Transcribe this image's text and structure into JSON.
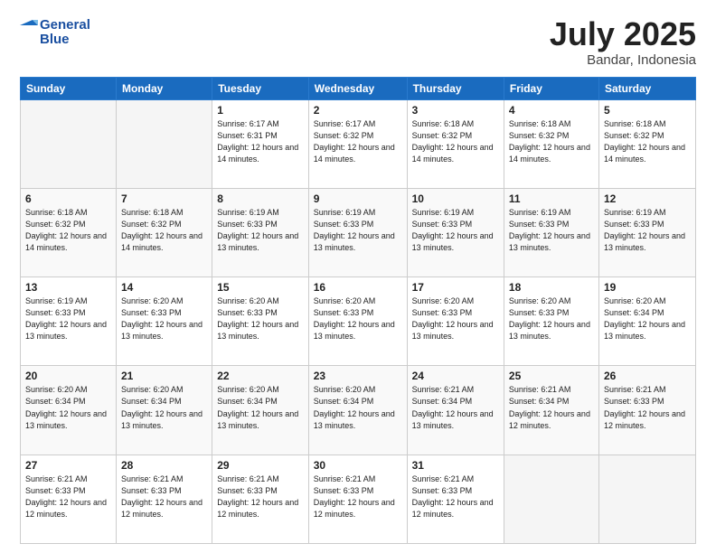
{
  "header": {
    "logo_line1": "General",
    "logo_line2": "Blue",
    "title": "July 2025",
    "location": "Bandar, Indonesia"
  },
  "weekdays": [
    "Sunday",
    "Monday",
    "Tuesday",
    "Wednesday",
    "Thursday",
    "Friday",
    "Saturday"
  ],
  "weeks": [
    [
      {
        "day": "",
        "info": ""
      },
      {
        "day": "",
        "info": ""
      },
      {
        "day": "1",
        "info": "Sunrise: 6:17 AM\nSunset: 6:31 PM\nDaylight: 12 hours and 14 minutes."
      },
      {
        "day": "2",
        "info": "Sunrise: 6:17 AM\nSunset: 6:32 PM\nDaylight: 12 hours and 14 minutes."
      },
      {
        "day": "3",
        "info": "Sunrise: 6:18 AM\nSunset: 6:32 PM\nDaylight: 12 hours and 14 minutes."
      },
      {
        "day": "4",
        "info": "Sunrise: 6:18 AM\nSunset: 6:32 PM\nDaylight: 12 hours and 14 minutes."
      },
      {
        "day": "5",
        "info": "Sunrise: 6:18 AM\nSunset: 6:32 PM\nDaylight: 12 hours and 14 minutes."
      }
    ],
    [
      {
        "day": "6",
        "info": "Sunrise: 6:18 AM\nSunset: 6:32 PM\nDaylight: 12 hours and 14 minutes."
      },
      {
        "day": "7",
        "info": "Sunrise: 6:18 AM\nSunset: 6:32 PM\nDaylight: 12 hours and 14 minutes."
      },
      {
        "day": "8",
        "info": "Sunrise: 6:19 AM\nSunset: 6:33 PM\nDaylight: 12 hours and 13 minutes."
      },
      {
        "day": "9",
        "info": "Sunrise: 6:19 AM\nSunset: 6:33 PM\nDaylight: 12 hours and 13 minutes."
      },
      {
        "day": "10",
        "info": "Sunrise: 6:19 AM\nSunset: 6:33 PM\nDaylight: 12 hours and 13 minutes."
      },
      {
        "day": "11",
        "info": "Sunrise: 6:19 AM\nSunset: 6:33 PM\nDaylight: 12 hours and 13 minutes."
      },
      {
        "day": "12",
        "info": "Sunrise: 6:19 AM\nSunset: 6:33 PM\nDaylight: 12 hours and 13 minutes."
      }
    ],
    [
      {
        "day": "13",
        "info": "Sunrise: 6:19 AM\nSunset: 6:33 PM\nDaylight: 12 hours and 13 minutes."
      },
      {
        "day": "14",
        "info": "Sunrise: 6:20 AM\nSunset: 6:33 PM\nDaylight: 12 hours and 13 minutes."
      },
      {
        "day": "15",
        "info": "Sunrise: 6:20 AM\nSunset: 6:33 PM\nDaylight: 12 hours and 13 minutes."
      },
      {
        "day": "16",
        "info": "Sunrise: 6:20 AM\nSunset: 6:33 PM\nDaylight: 12 hours and 13 minutes."
      },
      {
        "day": "17",
        "info": "Sunrise: 6:20 AM\nSunset: 6:33 PM\nDaylight: 12 hours and 13 minutes."
      },
      {
        "day": "18",
        "info": "Sunrise: 6:20 AM\nSunset: 6:33 PM\nDaylight: 12 hours and 13 minutes."
      },
      {
        "day": "19",
        "info": "Sunrise: 6:20 AM\nSunset: 6:34 PM\nDaylight: 12 hours and 13 minutes."
      }
    ],
    [
      {
        "day": "20",
        "info": "Sunrise: 6:20 AM\nSunset: 6:34 PM\nDaylight: 12 hours and 13 minutes."
      },
      {
        "day": "21",
        "info": "Sunrise: 6:20 AM\nSunset: 6:34 PM\nDaylight: 12 hours and 13 minutes."
      },
      {
        "day": "22",
        "info": "Sunrise: 6:20 AM\nSunset: 6:34 PM\nDaylight: 12 hours and 13 minutes."
      },
      {
        "day": "23",
        "info": "Sunrise: 6:20 AM\nSunset: 6:34 PM\nDaylight: 12 hours and 13 minutes."
      },
      {
        "day": "24",
        "info": "Sunrise: 6:21 AM\nSunset: 6:34 PM\nDaylight: 12 hours and 13 minutes."
      },
      {
        "day": "25",
        "info": "Sunrise: 6:21 AM\nSunset: 6:34 PM\nDaylight: 12 hours and 12 minutes."
      },
      {
        "day": "26",
        "info": "Sunrise: 6:21 AM\nSunset: 6:33 PM\nDaylight: 12 hours and 12 minutes."
      }
    ],
    [
      {
        "day": "27",
        "info": "Sunrise: 6:21 AM\nSunset: 6:33 PM\nDaylight: 12 hours and 12 minutes."
      },
      {
        "day": "28",
        "info": "Sunrise: 6:21 AM\nSunset: 6:33 PM\nDaylight: 12 hours and 12 minutes."
      },
      {
        "day": "29",
        "info": "Sunrise: 6:21 AM\nSunset: 6:33 PM\nDaylight: 12 hours and 12 minutes."
      },
      {
        "day": "30",
        "info": "Sunrise: 6:21 AM\nSunset: 6:33 PM\nDaylight: 12 hours and 12 minutes."
      },
      {
        "day": "31",
        "info": "Sunrise: 6:21 AM\nSunset: 6:33 PM\nDaylight: 12 hours and 12 minutes."
      },
      {
        "day": "",
        "info": ""
      },
      {
        "day": "",
        "info": ""
      }
    ]
  ]
}
